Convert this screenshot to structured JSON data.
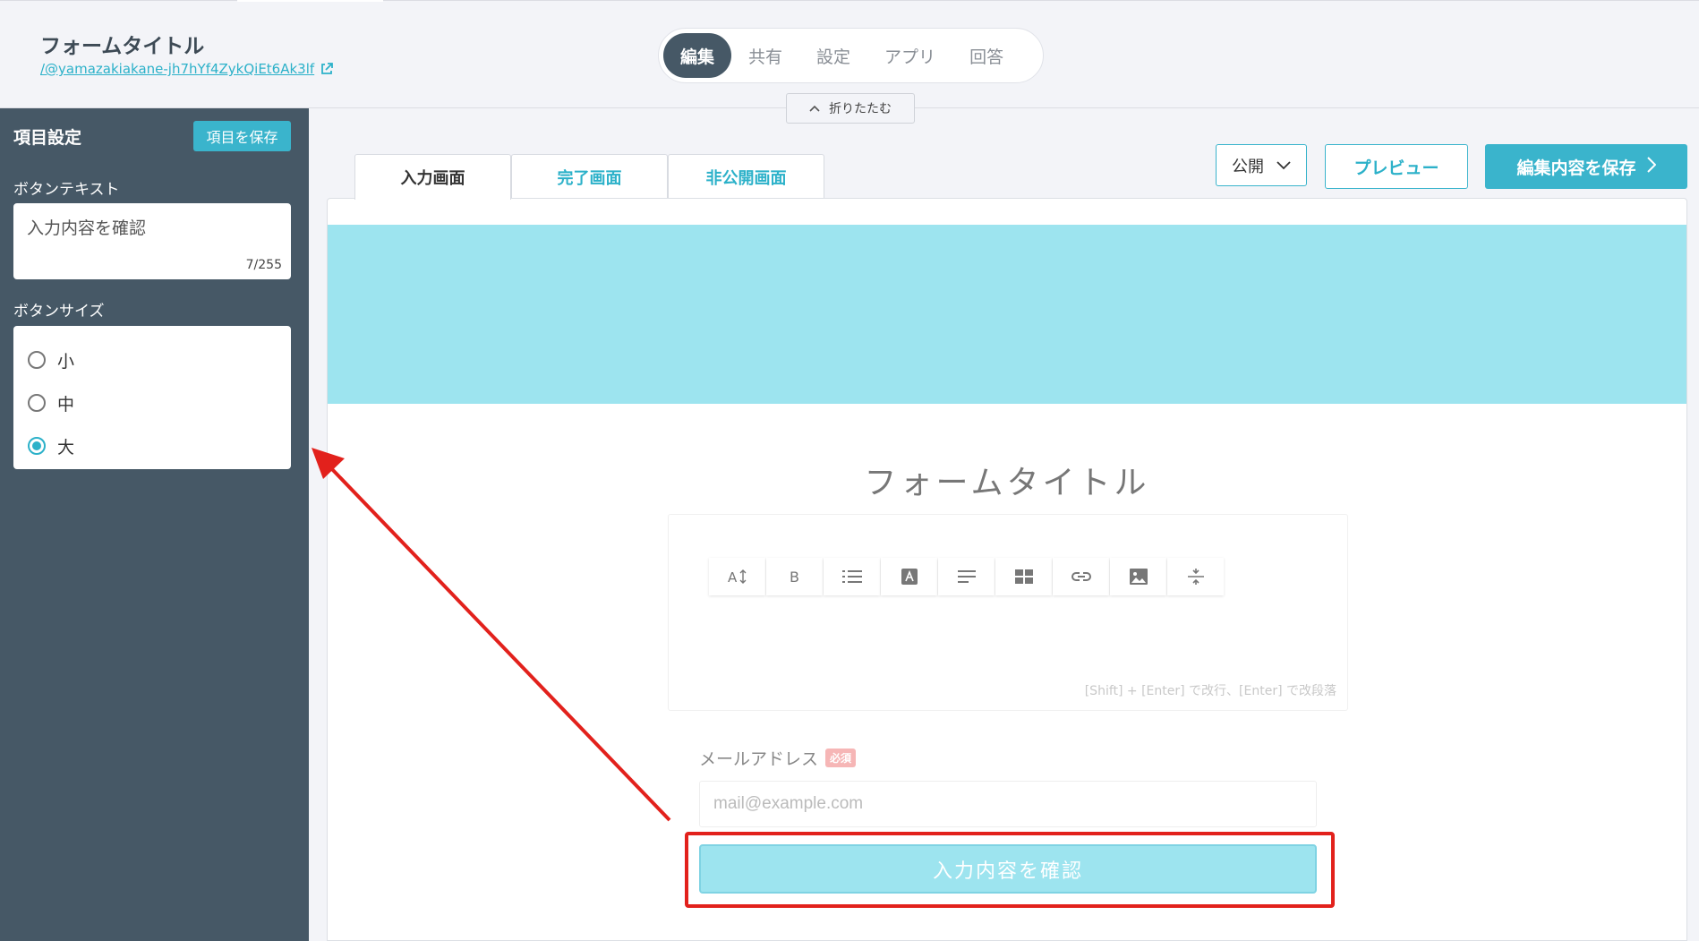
{
  "header": {
    "form_title": "フォームタイトル",
    "form_url": "/@yamazakiakane-jh7hYf4ZykQiEt6Ak3lf",
    "nav_tabs": [
      {
        "label": "編集",
        "active": true
      },
      {
        "label": "共有",
        "active": false
      },
      {
        "label": "設定",
        "active": false
      },
      {
        "label": "アプリ",
        "active": false
      },
      {
        "label": "回答",
        "active": false
      }
    ],
    "collapse_label": "折りたたむ"
  },
  "sidebar": {
    "title": "項目設定",
    "save_label": "項目を保存",
    "button_text_label": "ボタンテキスト",
    "button_text_value": "入力内容を確認",
    "counter": "7/255",
    "button_size_label": "ボタンサイズ",
    "size_options": [
      {
        "label": "小",
        "checked": false
      },
      {
        "label": "中",
        "checked": false
      },
      {
        "label": "大",
        "checked": true
      }
    ]
  },
  "content_tabs": [
    {
      "label": "入力画面",
      "active": true
    },
    {
      "label": "完了画面",
      "active": false
    },
    {
      "label": "非公開画面",
      "active": false
    }
  ],
  "actions": {
    "publish_value": "公開",
    "preview_label": "プレビュー",
    "save_label": "編集内容を保存"
  },
  "form": {
    "title": "フォームタイトル",
    "toolbar_icons": [
      "font-size-icon",
      "bold-icon",
      "list-icon",
      "text-color-icon",
      "align-icon",
      "table-icon",
      "link-icon",
      "image-icon",
      "divider-icon"
    ],
    "editor_hint": "[Shift] + [Enter] で改行、[Enter] で改段落",
    "email_label": "メールアドレス",
    "required_badge": "必須",
    "email_placeholder": "mail@example.com",
    "confirm_button": "入力内容を確認"
  },
  "colors": {
    "accent": "#3ab4cc",
    "sidebar_bg": "#465866",
    "banner": "#9de4ef",
    "annotation": "#e2211c"
  }
}
